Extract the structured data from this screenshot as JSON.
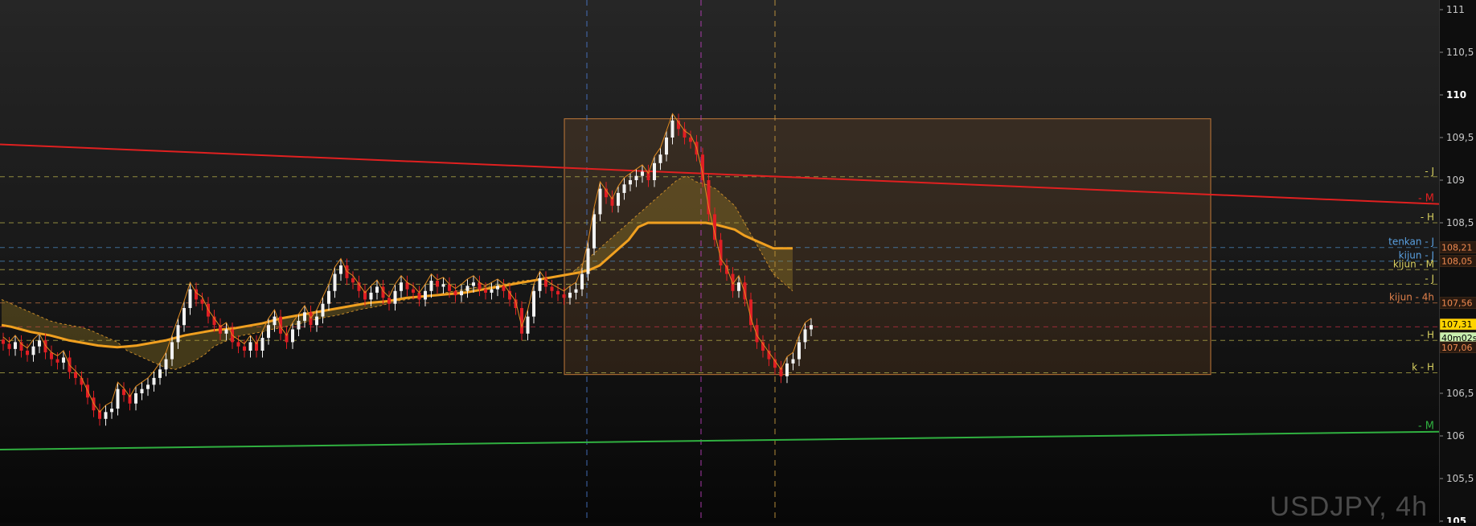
{
  "chart_data": {
    "type": "candlestick",
    "symbol": "USDJPY",
    "timeframe": "4h",
    "watermark": "USDJPY, 4h",
    "ylim": [
      104.85,
      111.15
    ],
    "y_ticks": [
      {
        "value": 111,
        "label": "111",
        "bold": false
      },
      {
        "value": 110.5,
        "label": "110,5",
        "bold": false
      },
      {
        "value": 110,
        "label": "110",
        "bold": true
      },
      {
        "value": 109.5,
        "label": "109,5",
        "bold": false
      },
      {
        "value": 109,
        "label": "109",
        "bold": false
      },
      {
        "value": 108.5,
        "label": "108,5",
        "bold": false
      },
      {
        "value": 106.5,
        "label": "106,5",
        "bold": false
      },
      {
        "value": 106,
        "label": "106",
        "bold": false
      },
      {
        "value": 105.5,
        "label": "105,5",
        "bold": false
      },
      {
        "value": 105,
        "label": "105",
        "bold": true
      }
    ],
    "price_tags": [
      {
        "value": 108.21,
        "label": "108,21",
        "bg": "#2a1a10",
        "fg": "#f08a50"
      },
      {
        "value": 108.05,
        "label": "108,05",
        "bg": "#2a1a10",
        "fg": "#f08a50"
      },
      {
        "value": 107.56,
        "label": "107,56",
        "bg": "#2a1a10",
        "fg": "#f08a50"
      },
      {
        "value": 107.31,
        "label": "107,31",
        "bg": "#ffd400",
        "fg": "#000000"
      },
      {
        "value": 107.15,
        "label": "40m02s",
        "bg": "#c9f0b0",
        "fg": "#000000"
      },
      {
        "value": 107.04,
        "label": "107,06",
        "bg": "#2a1a10",
        "fg": "#f08a50"
      }
    ],
    "level_lines": [
      {
        "value": 109.04,
        "label": "- J",
        "color": "#b8b04a",
        "label_color": "#d8d060"
      },
      {
        "value": 108.5,
        "label": "- H",
        "color": "#b8b04a",
        "label_color": "#d8d060"
      },
      {
        "value": 108.21,
        "label": "tenkan - J",
        "color": "#4a88c0",
        "label_color": "#5aa0e0"
      },
      {
        "value": 108.05,
        "label": "kijun - J",
        "color": "#4a88c0",
        "label_color": "#5aa0e0"
      },
      {
        "value": 107.95,
        "label": "kijun - M",
        "color": "#b8b04a",
        "label_color": "#d8d060"
      },
      {
        "value": 107.78,
        "label": "- J",
        "color": "#b8b04a",
        "label_color": "#d8d060"
      },
      {
        "value": 107.56,
        "label": "kijun - 4h",
        "color": "#c07040",
        "label_color": "#e0804a"
      },
      {
        "value": 107.28,
        "label": "",
        "color": "#c03040",
        "label_color": "#e04050"
      },
      {
        "value": 107.12,
        "label": "- H",
        "color": "#b8b04a",
        "label_color": "#d8d060"
      },
      {
        "value": 106.74,
        "label": "k - H",
        "color": "#b8b04a",
        "label_color": "#d8d060"
      }
    ],
    "red_trendline": {
      "label": "- M",
      "color": "#e02020",
      "points": [
        [
          0,
          109.42
        ],
        [
          1836,
          108.72
        ]
      ]
    },
    "green_trendline": {
      "label": "- M",
      "color": "#30b040",
      "points": [
        [
          0,
          105.84
        ],
        [
          1836,
          106.05
        ]
      ]
    },
    "range_box": {
      "x0": 702,
      "x1": 1506,
      "y_top": 109.72,
      "y_bottom": 106.72
    },
    "vertical_markers": [
      {
        "x": 730,
        "color": "#4a7ad0"
      },
      {
        "x": 872,
        "color": "#c040c0"
      },
      {
        "x": 964,
        "color": "#d0a040"
      }
    ],
    "candles_close": [
      107.08,
      107.02,
      107.1,
      107.0,
      106.95,
      107.05,
      107.12,
      106.98,
      106.9,
      106.86,
      106.92,
      106.75,
      106.68,
      106.6,
      106.45,
      106.3,
      106.2,
      106.28,
      106.32,
      106.55,
      106.48,
      106.38,
      106.5,
      106.55,
      106.6,
      106.68,
      106.78,
      106.9,
      107.1,
      107.3,
      107.5,
      107.72,
      107.6,
      107.55,
      107.4,
      107.3,
      107.2,
      107.25,
      107.1,
      107.05,
      107.0,
      107.1,
      107.0,
      107.15,
      107.3,
      107.4,
      107.2,
      107.1,
      107.25,
      107.35,
      107.45,
      107.3,
      107.4,
      107.55,
      107.7,
      107.9,
      108.0,
      107.85,
      107.8,
      107.7,
      107.6,
      107.68,
      107.75,
      107.62,
      107.55,
      107.7,
      107.8,
      107.72,
      107.68,
      107.6,
      107.7,
      107.82,
      107.75,
      107.78,
      107.7,
      107.65,
      107.7,
      107.76,
      107.8,
      107.72,
      107.68,
      107.72,
      107.76,
      107.7,
      107.6,
      107.5,
      107.2,
      107.4,
      107.7,
      107.85,
      107.75,
      107.7,
      107.66,
      107.62,
      107.68,
      107.72,
      107.9,
      108.2,
      108.6,
      108.9,
      108.8,
      108.7,
      108.85,
      108.95,
      109.0,
      109.05,
      109.1,
      109.0,
      109.2,
      109.3,
      109.5,
      109.7,
      109.6,
      109.5,
      109.45,
      109.3,
      109.0,
      108.6,
      108.3,
      108.0,
      107.9,
      107.7,
      107.8,
      107.6,
      107.3,
      107.1,
      107.0,
      106.9,
      106.8,
      106.7,
      106.85,
      106.9,
      107.1,
      107.25,
      107.3
    ],
    "cloud_line_a": [
      107.6,
      107.55,
      107.5,
      107.45,
      107.4,
      107.35,
      107.32,
      107.3,
      107.28,
      107.25,
      107.2,
      107.15,
      107.1,
      107.0,
      106.95,
      106.9,
      106.85,
      106.8,
      106.78,
      106.82,
      106.88,
      106.95,
      107.05,
      107.1,
      107.15,
      107.18,
      107.2,
      107.22,
      107.25,
      107.27,
      107.3,
      107.32,
      107.35,
      107.38,
      107.4,
      107.42,
      107.45,
      107.48,
      107.5,
      107.52,
      107.55,
      107.58,
      107.6,
      107.62,
      107.64,
      107.65,
      107.68,
      107.7,
      107.72,
      107.74,
      107.75,
      107.76,
      107.78,
      107.8,
      107.82,
      107.83,
      107.84,
      107.86,
      107.88,
      107.9,
      108.0,
      108.1,
      108.2,
      108.3,
      108.4,
      108.5,
      108.6,
      108.7,
      108.8,
      108.9,
      109.0,
      109.05,
      108.98,
      108.95,
      108.9,
      108.8,
      108.7,
      108.5,
      108.3,
      108.1,
      107.9,
      107.8,
      107.7
    ],
    "cloud_line_b": [
      107.3,
      107.28,
      107.25,
      107.22,
      107.2,
      107.18,
      107.15,
      107.12,
      107.1,
      107.08,
      107.06,
      107.05,
      107.04,
      107.05,
      107.06,
      107.08,
      107.1,
      107.12,
      107.15,
      107.18,
      107.2,
      107.22,
      107.24,
      107.25,
      107.26,
      107.28,
      107.3,
      107.32,
      107.35,
      107.38,
      107.4,
      107.42,
      107.44,
      107.46,
      107.48,
      107.5,
      107.52,
      107.54,
      107.56,
      107.57,
      107.58,
      107.6,
      107.62,
      107.63,
      107.64,
      107.65,
      107.66,
      107.67,
      107.68,
      107.7,
      107.72,
      107.74,
      107.76,
      107.78,
      107.8,
      107.82,
      107.84,
      107.86,
      107.88,
      107.9,
      107.92,
      107.95,
      108.0,
      108.1,
      108.2,
      108.3,
      108.45,
      108.5,
      108.5,
      108.5,
      108.5,
      108.5,
      108.5,
      108.5,
      108.48,
      108.45,
      108.42,
      108.35,
      108.3,
      108.25,
      108.2,
      108.2,
      108.2
    ]
  }
}
